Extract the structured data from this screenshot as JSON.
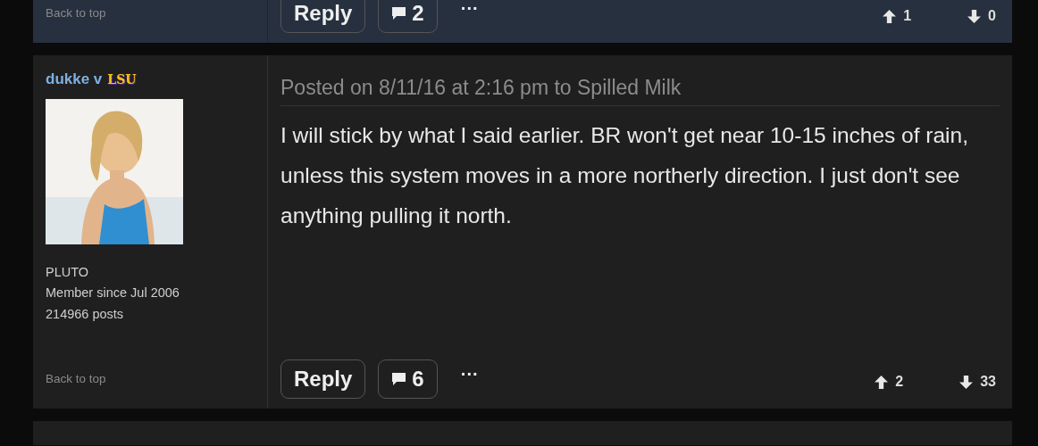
{
  "posts": [
    {
      "highlighted": true,
      "back_to_top": "Back to top",
      "reply": "Reply",
      "comments": "2",
      "more": "···",
      "upvotes": "1",
      "downvotes": "0"
    },
    {
      "highlighted": false,
      "username": "dukke v",
      "team": "LSU",
      "rank": "PLUTO",
      "member_since": "Member since Jul 2006",
      "post_count": "214966 posts",
      "posted": "Posted on 8/11/16 at 2:16 pm to Spilled Milk",
      "body": "I will stick by what I said earlier. BR won't get near 10-15 inches of rain, unless this system moves in a more northerly direction. I just don't see anything pulling it north.",
      "back_to_top": "Back to top",
      "reply": "Reply",
      "comments": "6",
      "more": "···",
      "upvotes": "2",
      "downvotes": "33"
    },
    {
      "highlighted": false
    }
  ]
}
